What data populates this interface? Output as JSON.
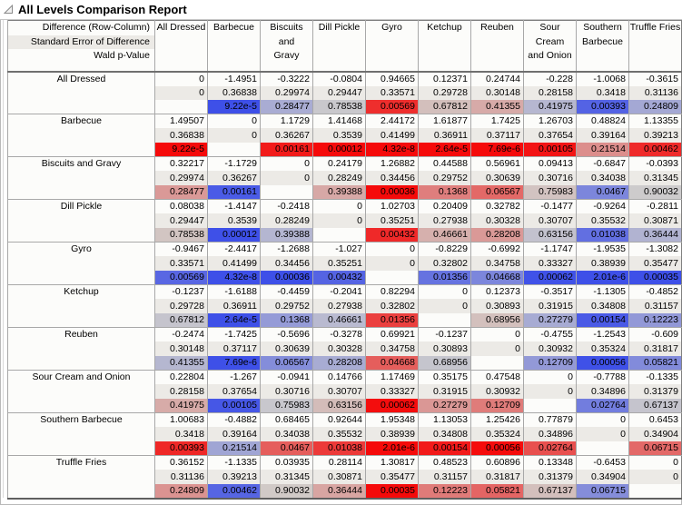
{
  "title": "All Levels Comparison Report",
  "colors": {
    "significant_positive": "#f50a0a",
    "significant_negative": "#3e50e8",
    "neutral": "#d0cecb",
    "se_row_bg": "#eceae6",
    "diff_row_bg": "#fcfcfa"
  },
  "header": {
    "row_label_lines": [
      "Difference (Row-Column)",
      "Standard Error of Difference",
      "Wald p-Value"
    ],
    "columns": [
      {
        "label": "All Dressed",
        "lines": [
          "All Dressed"
        ]
      },
      {
        "label": "Barbecue",
        "lines": [
          "Barbecue"
        ]
      },
      {
        "label": "Biscuits and Gravy",
        "lines": [
          "Biscuits",
          "and",
          "Gravy"
        ]
      },
      {
        "label": "Dill Pickle",
        "lines": [
          "Dill Pickle"
        ]
      },
      {
        "label": "Gyro",
        "lines": [
          "Gyro"
        ]
      },
      {
        "label": "Ketchup",
        "lines": [
          "Ketchup"
        ]
      },
      {
        "label": "Reuben",
        "lines": [
          "Reuben"
        ]
      },
      {
        "label": "Sour Cream and Onion",
        "lines": [
          "Sour",
          "Cream",
          "and Onion"
        ]
      },
      {
        "label": "Southern Barbecue",
        "lines": [
          "Southern",
          "Barbecue"
        ]
      },
      {
        "label": "Truffle Fries",
        "lines": [
          "Truffle Fries"
        ]
      }
    ]
  },
  "rows": [
    {
      "label": "All Dressed",
      "diff": [
        "0",
        "-1.4951",
        "-0.3222",
        "-0.0804",
        "0.94665",
        "0.12371",
        "0.24744",
        "-0.228",
        "-1.0068",
        "-0.3615"
      ],
      "se": [
        "0",
        "0.36838",
        "0.29974",
        "0.29447",
        "0.33571",
        "0.29728",
        "0.30148",
        "0.28158",
        "0.3418",
        "0.31136"
      ],
      "p": [
        "",
        "9.22e-5",
        "0.28477",
        "0.78538",
        "0.00569",
        "0.67812",
        "0.41355",
        "0.41975",
        "0.00393",
        "0.24809"
      ]
    },
    {
      "label": "Barbecue",
      "diff": [
        "1.49507",
        "0",
        "1.1729",
        "1.41468",
        "2.44172",
        "1.61877",
        "1.7425",
        "1.26703",
        "0.48824",
        "1.13355"
      ],
      "se": [
        "0.36838",
        "0",
        "0.36267",
        "0.3539",
        "0.41499",
        "0.36911",
        "0.37117",
        "0.37654",
        "0.39164",
        "0.39213"
      ],
      "p": [
        "9.22e-5",
        "",
        "0.00161",
        "0.00012",
        "4.32e-8",
        "2.64e-5",
        "7.69e-6",
        "0.00105",
        "0.21514",
        "0.00462"
      ]
    },
    {
      "label": "Biscuits and Gravy",
      "diff": [
        "0.32217",
        "-1.1729",
        "0",
        "0.24179",
        "1.26882",
        "0.44588",
        "0.56961",
        "0.09413",
        "-0.6847",
        "-0.0393"
      ],
      "se": [
        "0.29974",
        "0.36267",
        "0",
        "0.28249",
        "0.34456",
        "0.29752",
        "0.30639",
        "0.30716",
        "0.34038",
        "0.31345"
      ],
      "p": [
        "0.28477",
        "0.00161",
        "",
        "0.39388",
        "0.00036",
        "0.1368",
        "0.06567",
        "0.75983",
        "0.0467",
        "0.90032"
      ]
    },
    {
      "label": "Dill Pickle",
      "diff": [
        "0.08038",
        "-1.4147",
        "-0.2418",
        "0",
        "1.02703",
        "0.20409",
        "0.32782",
        "-0.1477",
        "-0.9264",
        "-0.2811"
      ],
      "se": [
        "0.29447",
        "0.3539",
        "0.28249",
        "0",
        "0.35251",
        "0.27938",
        "0.30328",
        "0.30707",
        "0.35532",
        "0.30871"
      ],
      "p": [
        "0.78538",
        "0.00012",
        "0.39388",
        "",
        "0.00432",
        "0.46661",
        "0.28208",
        "0.63156",
        "0.01038",
        "0.36444"
      ]
    },
    {
      "label": "Gyro",
      "diff": [
        "-0.9467",
        "-2.4417",
        "-1.2688",
        "-1.027",
        "0",
        "-0.8229",
        "-0.6992",
        "-1.1747",
        "-1.9535",
        "-1.3082"
      ],
      "se": [
        "0.33571",
        "0.41499",
        "0.34456",
        "0.35251",
        "0",
        "0.32802",
        "0.34758",
        "0.33327",
        "0.38939",
        "0.35477"
      ],
      "p": [
        "0.00569",
        "4.32e-8",
        "0.00036",
        "0.00432",
        "",
        "0.01356",
        "0.04668",
        "0.00062",
        "2.01e-6",
        "0.00035"
      ]
    },
    {
      "label": "Ketchup",
      "diff": [
        "-0.1237",
        "-1.6188",
        "-0.4459",
        "-0.2041",
        "0.82294",
        "0",
        "0.12373",
        "-0.3517",
        "-1.1305",
        "-0.4852"
      ],
      "se": [
        "0.29728",
        "0.36911",
        "0.29752",
        "0.27938",
        "0.32802",
        "0",
        "0.30893",
        "0.31915",
        "0.34808",
        "0.31157"
      ],
      "p": [
        "0.67812",
        "2.64e-5",
        "0.1368",
        "0.46661",
        "0.01356",
        "",
        "0.68956",
        "0.27279",
        "0.00154",
        "0.12223"
      ]
    },
    {
      "label": "Reuben",
      "diff": [
        "-0.2474",
        "-1.7425",
        "-0.5696",
        "-0.3278",
        "0.69921",
        "-0.1237",
        "0",
        "-0.4755",
        "-1.2543",
        "-0.609"
      ],
      "se": [
        "0.30148",
        "0.37117",
        "0.30639",
        "0.30328",
        "0.34758",
        "0.30893",
        "0",
        "0.30932",
        "0.35324",
        "0.31817"
      ],
      "p": [
        "0.41355",
        "7.69e-6",
        "0.06567",
        "0.28208",
        "0.04668",
        "0.68956",
        "",
        "0.12709",
        "0.00056",
        "0.05821"
      ]
    },
    {
      "label": "Sour Cream and Onion",
      "diff": [
        "0.22804",
        "-1.267",
        "-0.0941",
        "0.14766",
        "1.17469",
        "0.35175",
        "0.47548",
        "0",
        "-0.7788",
        "-0.1335"
      ],
      "se": [
        "0.28158",
        "0.37654",
        "0.30716",
        "0.30707",
        "0.33327",
        "0.31915",
        "0.30932",
        "0",
        "0.34896",
        "0.31379"
      ],
      "p": [
        "0.41975",
        "0.00105",
        "0.75983",
        "0.63156",
        "0.00062",
        "0.27279",
        "0.12709",
        "",
        "0.02764",
        "0.67137"
      ]
    },
    {
      "label": "Southern Barbecue",
      "diff": [
        "1.00683",
        "-0.4882",
        "0.68465",
        "0.92644",
        "1.95348",
        "1.13053",
        "1.25426",
        "0.77879",
        "0",
        "0.6453"
      ],
      "se": [
        "0.3418",
        "0.39164",
        "0.34038",
        "0.35532",
        "0.38939",
        "0.34808",
        "0.35324",
        "0.34896",
        "0",
        "0.34904"
      ],
      "p": [
        "0.00393",
        "0.21514",
        "0.0467",
        "0.01038",
        "2.01e-6",
        "0.00154",
        "0.00056",
        "0.02764",
        "",
        "0.06715"
      ]
    },
    {
      "label": "Truffle Fries",
      "diff": [
        "0.36152",
        "-1.1335",
        "0.03935",
        "0.28114",
        "1.30817",
        "0.48523",
        "0.60896",
        "0.13348",
        "-0.6453",
        "0"
      ],
      "se": [
        "0.31136",
        "0.39213",
        "0.31345",
        "0.30871",
        "0.35477",
        "0.31157",
        "0.31817",
        "0.31379",
        "0.34904",
        "0"
      ],
      "p": [
        "0.24809",
        "0.00462",
        "0.90032",
        "0.36444",
        "0.00035",
        "0.12223",
        "0.05821",
        "0.67137",
        "0.06715",
        ""
      ]
    }
  ]
}
